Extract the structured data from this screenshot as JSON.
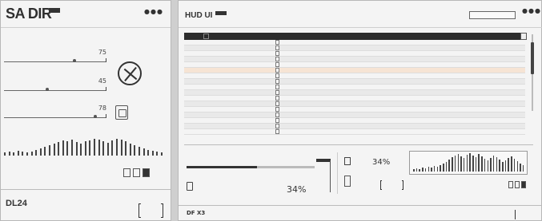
{
  "left_panel": {
    "title": "SA DIR",
    "dots": "●●●",
    "sliders": [
      {
        "value": "75",
        "pos": 0.7
      },
      {
        "value": "45",
        "pos": 0.42
      },
      {
        "value": "78",
        "pos": 0.92
      }
    ],
    "footer_title": "DL24"
  },
  "right_panel": {
    "title": "HUD UI",
    "dots": "●●●",
    "table_rows": 17,
    "highlight_row": 5,
    "load_percent": "34%",
    "check_percent": "34%",
    "load_fill": 0.55,
    "footer_title": "DF X3"
  }
}
